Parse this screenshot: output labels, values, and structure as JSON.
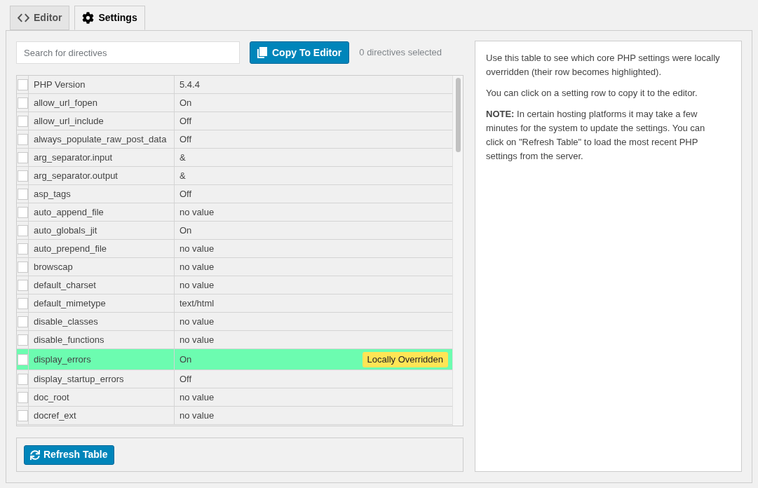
{
  "tabs": [
    {
      "label": "Editor",
      "selected": false
    },
    {
      "label": "Settings",
      "selected": true
    }
  ],
  "search": {
    "placeholder": "Search for directives"
  },
  "copy_button": {
    "label": "Copy To Editor"
  },
  "selection_count": "0 directives selected",
  "table": {
    "rows": [
      {
        "name": "PHP Version",
        "value": "5.4.4",
        "checked": false,
        "overridden": false
      },
      {
        "name": "allow_url_fopen",
        "value": "On",
        "checked": false,
        "overridden": false
      },
      {
        "name": "allow_url_include",
        "value": "Off",
        "checked": false,
        "overridden": false
      },
      {
        "name": "always_populate_raw_post_data",
        "value": "Off",
        "checked": false,
        "overridden": false
      },
      {
        "name": "arg_separator.input",
        "value": "&",
        "checked": false,
        "overridden": false
      },
      {
        "name": "arg_separator.output",
        "value": "&",
        "checked": false,
        "overridden": false
      },
      {
        "name": "asp_tags",
        "value": "Off",
        "checked": false,
        "overridden": false
      },
      {
        "name": "auto_append_file",
        "value": "no value",
        "checked": false,
        "overridden": false
      },
      {
        "name": "auto_globals_jit",
        "value": "On",
        "checked": false,
        "overridden": false
      },
      {
        "name": "auto_prepend_file",
        "value": "no value",
        "checked": false,
        "overridden": false
      },
      {
        "name": "browscap",
        "value": "no value",
        "checked": false,
        "overridden": false
      },
      {
        "name": "default_charset",
        "value": "no value",
        "checked": false,
        "overridden": false
      },
      {
        "name": "default_mimetype",
        "value": "text/html",
        "checked": false,
        "overridden": false
      },
      {
        "name": "disable_classes",
        "value": "no value",
        "checked": false,
        "overridden": false
      },
      {
        "name": "disable_functions",
        "value": "no value",
        "checked": false,
        "overridden": false
      },
      {
        "name": "display_errors",
        "value": "On",
        "checked": false,
        "overridden": true,
        "badge": "Locally Overridden"
      },
      {
        "name": "display_startup_errors",
        "value": "Off",
        "checked": false,
        "overridden": false
      },
      {
        "name": "doc_root",
        "value": "no value",
        "checked": false,
        "overridden": false
      },
      {
        "name": "docref_ext",
        "value": "no value",
        "checked": false,
        "overridden": false
      }
    ]
  },
  "refresh_button": {
    "label": "Refresh Table"
  },
  "help": {
    "paragraphs": [
      "Use this table to see which core PHP settings were locally overridden (their row becomes highlighted).",
      "You can click on a setting row to copy it to the editor.",
      "**NOTE:** In certain hosting platforms it may take a few minutes for the system to update the settings. You can click on \"Refresh Table\" to load the most recent PHP settings from the server."
    ]
  }
}
